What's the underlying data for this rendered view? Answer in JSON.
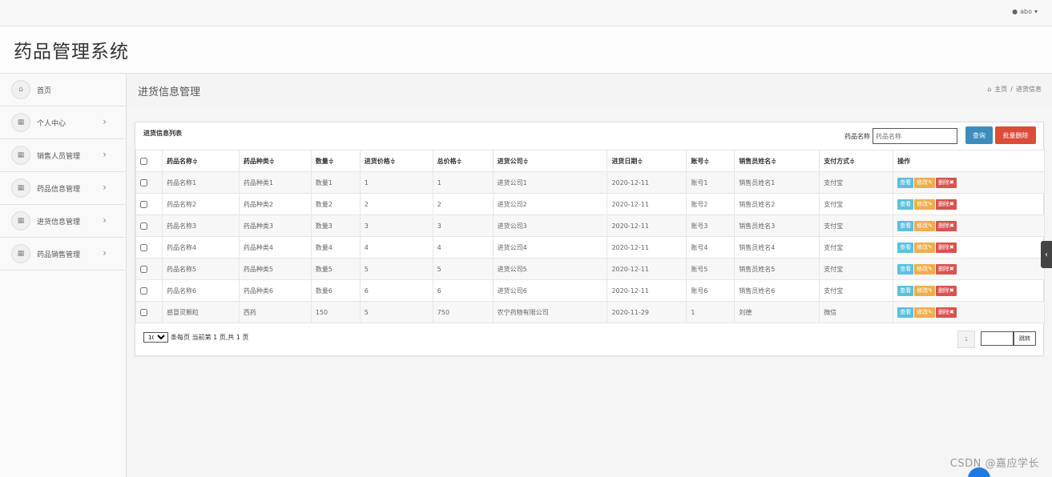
{
  "topbar": {
    "user": "abo",
    "user_icon": "user-icon",
    "caret": "▾"
  },
  "app": {
    "title": "药品管理系统"
  },
  "sidebar": {
    "items": [
      {
        "label": "首页",
        "icon": "home-icon",
        "has_arrow": false
      },
      {
        "label": "个人中心",
        "icon": "grid-icon",
        "has_arrow": true
      },
      {
        "label": "销售人员管理",
        "icon": "grid-icon",
        "has_arrow": true
      },
      {
        "label": "药品信息管理",
        "icon": "grid-icon",
        "has_arrow": true
      },
      {
        "label": "进货信息管理",
        "icon": "grid-icon",
        "has_arrow": true
      },
      {
        "label": "药品销售管理",
        "icon": "grid-icon",
        "has_arrow": true
      }
    ]
  },
  "header": {
    "title": "进货信息管理",
    "breadcrumb": {
      "home": "主页",
      "sep": "/",
      "current": "进货信息"
    }
  },
  "panel": {
    "title": "进货信息列表",
    "search_label": "药品名称",
    "search_placeholder": "药品名称",
    "query_button": "查询",
    "batch_delete_button": "批量删除"
  },
  "table": {
    "columns": [
      "药品名称≑",
      "药品种类≑",
      "数量≑",
      "进货价格≑",
      "总价格≑",
      "进货公司≑",
      "进货日期≑",
      "账号≑",
      "销售员姓名≑",
      "支付方式≑",
      "操作"
    ],
    "rows": [
      [
        "药品名称1",
        "药品种类1",
        "数量1",
        "1",
        "1",
        "进货公司1",
        "2020-12-11",
        "账号1",
        "销售员姓名1",
        "支付宝"
      ],
      [
        "药品名称2",
        "药品种类2",
        "数量2",
        "2",
        "2",
        "进货公司2",
        "2020-12-11",
        "账号2",
        "销售员姓名2",
        "支付宝"
      ],
      [
        "药品名称3",
        "药品种类3",
        "数量3",
        "3",
        "3",
        "进货公司3",
        "2020-12-11",
        "账号3",
        "销售员姓名3",
        "支付宝"
      ],
      [
        "药品名称4",
        "药品种类4",
        "数量4",
        "4",
        "4",
        "进货公司4",
        "2020-12-11",
        "账号4",
        "销售员姓名4",
        "支付宝"
      ],
      [
        "药品名称5",
        "药品种类5",
        "数量5",
        "5",
        "5",
        "进货公司5",
        "2020-12-11",
        "账号5",
        "销售员姓名5",
        "支付宝"
      ],
      [
        "药品名称6",
        "药品种类6",
        "数量6",
        "6",
        "6",
        "进货公司6",
        "2020-12-11",
        "账号6",
        "销售员姓名6",
        "支付宝"
      ],
      [
        "感冒灵颗粒",
        "西药",
        "150",
        "5",
        "750",
        "农宁药物有限公司",
        "2020-11-29",
        "1",
        "刘德",
        "微信"
      ]
    ],
    "actions": {
      "view": "查看",
      "edit": "修改✎",
      "delete": "删除✖"
    }
  },
  "pager": {
    "page_size": "10",
    "summary": "条每页 当前第 1 页,共 1 页",
    "current_page": "1",
    "jump_button": "跳转"
  },
  "watermark": "CSDN @嘉应学长",
  "colors": {
    "primary": "#3c8dbc",
    "danger": "#dd4b39",
    "info": "#5bc0de",
    "warning": "#f0ad4e"
  }
}
